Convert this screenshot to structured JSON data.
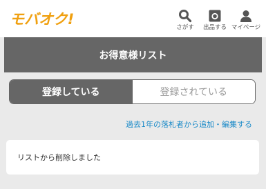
{
  "header": {
    "logo_text": "モバオク!",
    "nav": [
      {
        "label": "さがす",
        "icon": "search-icon"
      },
      {
        "label": "出品する",
        "icon": "camera-icon"
      },
      {
        "label": "マイページ",
        "icon": "user-icon"
      }
    ]
  },
  "page": {
    "title": "お得意様リスト"
  },
  "tabs": [
    {
      "label": "登録している",
      "selected": true
    },
    {
      "label": "登録されている",
      "selected": false
    }
  ],
  "link": {
    "text": "過去1年の落札者から追加・編集する"
  },
  "message": {
    "text": "リストから削除しました"
  },
  "colors": {
    "brand": "#f0a010",
    "title_band": "#666666",
    "link": "#1a8ac8",
    "background": "#eaeaea"
  }
}
